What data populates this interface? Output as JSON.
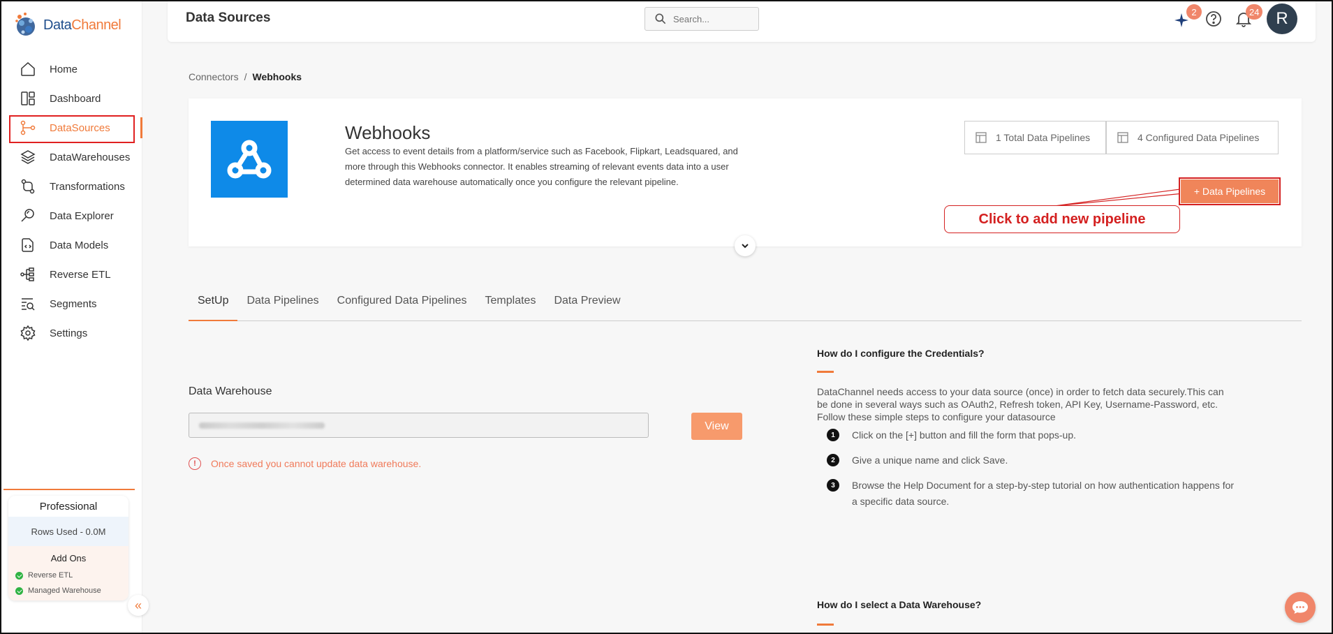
{
  "brand": {
    "name_part1": "Data",
    "name_part2": "Channel"
  },
  "sidebar": {
    "items": [
      {
        "label": "Home",
        "icon": "home-icon"
      },
      {
        "label": "Dashboard",
        "icon": "dashboard-icon"
      },
      {
        "label": "DataSources",
        "icon": "datasources-icon",
        "active": true
      },
      {
        "label": "DataWarehouses",
        "icon": "layers-icon"
      },
      {
        "label": "Transformations",
        "icon": "transform-icon"
      },
      {
        "label": "Data Explorer",
        "icon": "explorer-icon"
      },
      {
        "label": "Data Models",
        "icon": "models-icon"
      },
      {
        "label": "Reverse ETL",
        "icon": "reverse-etl-icon"
      },
      {
        "label": "Segments",
        "icon": "segments-icon"
      },
      {
        "label": "Settings",
        "icon": "gear-icon"
      }
    ],
    "plan": {
      "name": "Professional",
      "rows_used": "Rows Used - 0.0M",
      "addons_title": "Add Ons",
      "addons": [
        "Reverse ETL",
        "Managed Warehouse"
      ]
    }
  },
  "header": {
    "title": "Data Sources",
    "search_placeholder": "Search...",
    "ai_badge": "2",
    "notification_badge": "24",
    "avatar_initial": "R"
  },
  "breadcrumb": {
    "parent": "Connectors",
    "separator": "/",
    "current": "Webhooks"
  },
  "connector": {
    "name": "Webhooks",
    "description": "Get access to event details from a platform/service such as Facebook, Flipkart, Leadsquared, and more through this Webhooks connector. It enables streaming of relevant events data into a user determined data warehouse automatically once you configure the relevant pipeline.",
    "total_pipelines": "1 Total Data Pipelines",
    "configured_pipelines": "4 Configured Data Pipelines",
    "add_button": "+ Data Pipelines",
    "annotation": "Click to add new pipeline",
    "logo_color": "#0e8ae8"
  },
  "tabs": [
    "SetUp",
    "Data Pipelines",
    "Configured Data Pipelines",
    "Templates",
    "Data Preview"
  ],
  "setup": {
    "warehouse_label": "Data Warehouse",
    "view_button": "View",
    "warning": "Once saved you cannot update data warehouse."
  },
  "help": {
    "credentials_title": "How do I configure the Credentials?",
    "credentials_intro": "DataChannel needs access to your data source (once) in order to fetch data securely.This can be done in several ways such as OAuth2, Refresh token, API Key, Username-Password, etc.",
    "steps_intro": "Follow these simple steps to configure your datasource",
    "steps": [
      "Click on the [+] button and fill the form that pops-up.",
      "Give a unique name and click Save.",
      "Browse the Help Document for a step-by-step tutorial on how authentication happens for a specific data source."
    ],
    "warehouse_title": "How do I select a Data Warehouse?"
  },
  "colors": {
    "accent": "#f07a3a",
    "annotation": "#d42020"
  }
}
